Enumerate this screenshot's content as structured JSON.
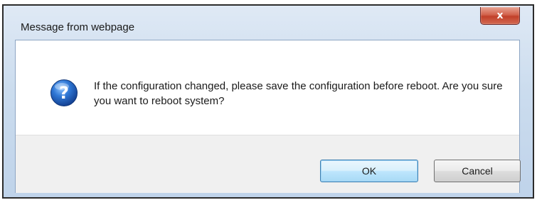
{
  "dialog": {
    "title": "Message from webpage",
    "close_label": "x",
    "icon": "question-icon",
    "icon_glyph": "?",
    "message": "If the configuration changed, please save the configuration before reboot. Are you sure you want to reboot system?",
    "buttons": {
      "ok_label": "OK",
      "cancel_label": "Cancel"
    }
  },
  "colors": {
    "titlebar": "#cbdcee",
    "close_button": "#c1402a",
    "icon_blue": "#1f5fb8",
    "button_bar": "#f0f0f0"
  }
}
